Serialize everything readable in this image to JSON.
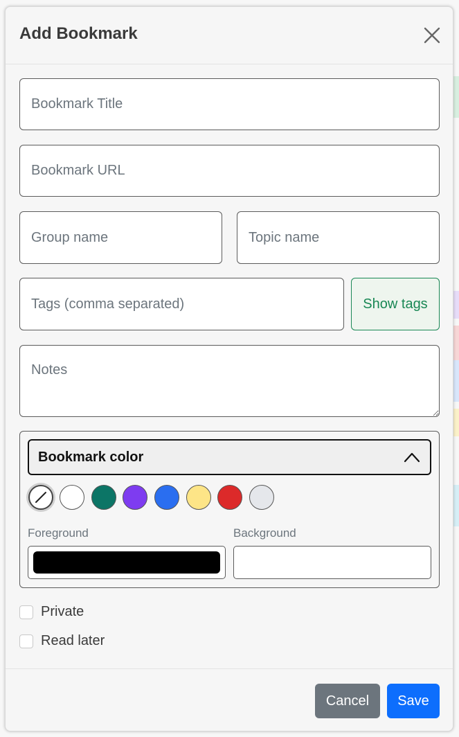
{
  "dialog": {
    "title": "Add Bookmark",
    "close_icon": "close-icon"
  },
  "fields": {
    "title": {
      "placeholder": "Bookmark Title",
      "value": ""
    },
    "url": {
      "placeholder": "Bookmark URL",
      "value": ""
    },
    "group": {
      "placeholder": "Group name",
      "value": ""
    },
    "topic": {
      "placeholder": "Topic name",
      "value": ""
    },
    "tags": {
      "placeholder": "Tags (comma separated)",
      "value": ""
    },
    "notes": {
      "placeholder": "Notes",
      "value": ""
    }
  },
  "show_tags_label": "Show tags",
  "color": {
    "toggle_label": "Bookmark color",
    "toggle_icon": "chevron-up-icon",
    "swatches": [
      {
        "name": "none",
        "hex": "#ffffff",
        "icon": "no-color-icon",
        "selected": true
      },
      {
        "name": "white",
        "hex": "#ffffff"
      },
      {
        "name": "teal",
        "hex": "#0c7566"
      },
      {
        "name": "purple",
        "hex": "#7e3cf0"
      },
      {
        "name": "blue",
        "hex": "#2a6ef0"
      },
      {
        "name": "yellow",
        "hex": "#fde587"
      },
      {
        "name": "red",
        "hex": "#dc2a2a"
      },
      {
        "name": "gray",
        "hex": "#e5e7eb"
      }
    ],
    "foreground_label": "Foreground",
    "background_label": "Background",
    "foreground_hex": "#000000",
    "background_hex": "#ffffff"
  },
  "options": {
    "private_label": "Private",
    "private_checked": false,
    "read_later_label": "Read later",
    "read_later_checked": false
  },
  "footer": {
    "cancel_label": "Cancel",
    "save_label": "Save"
  },
  "colors": {
    "primary": "#0d6efd",
    "secondary": "#6c757d",
    "success": "#198754"
  }
}
